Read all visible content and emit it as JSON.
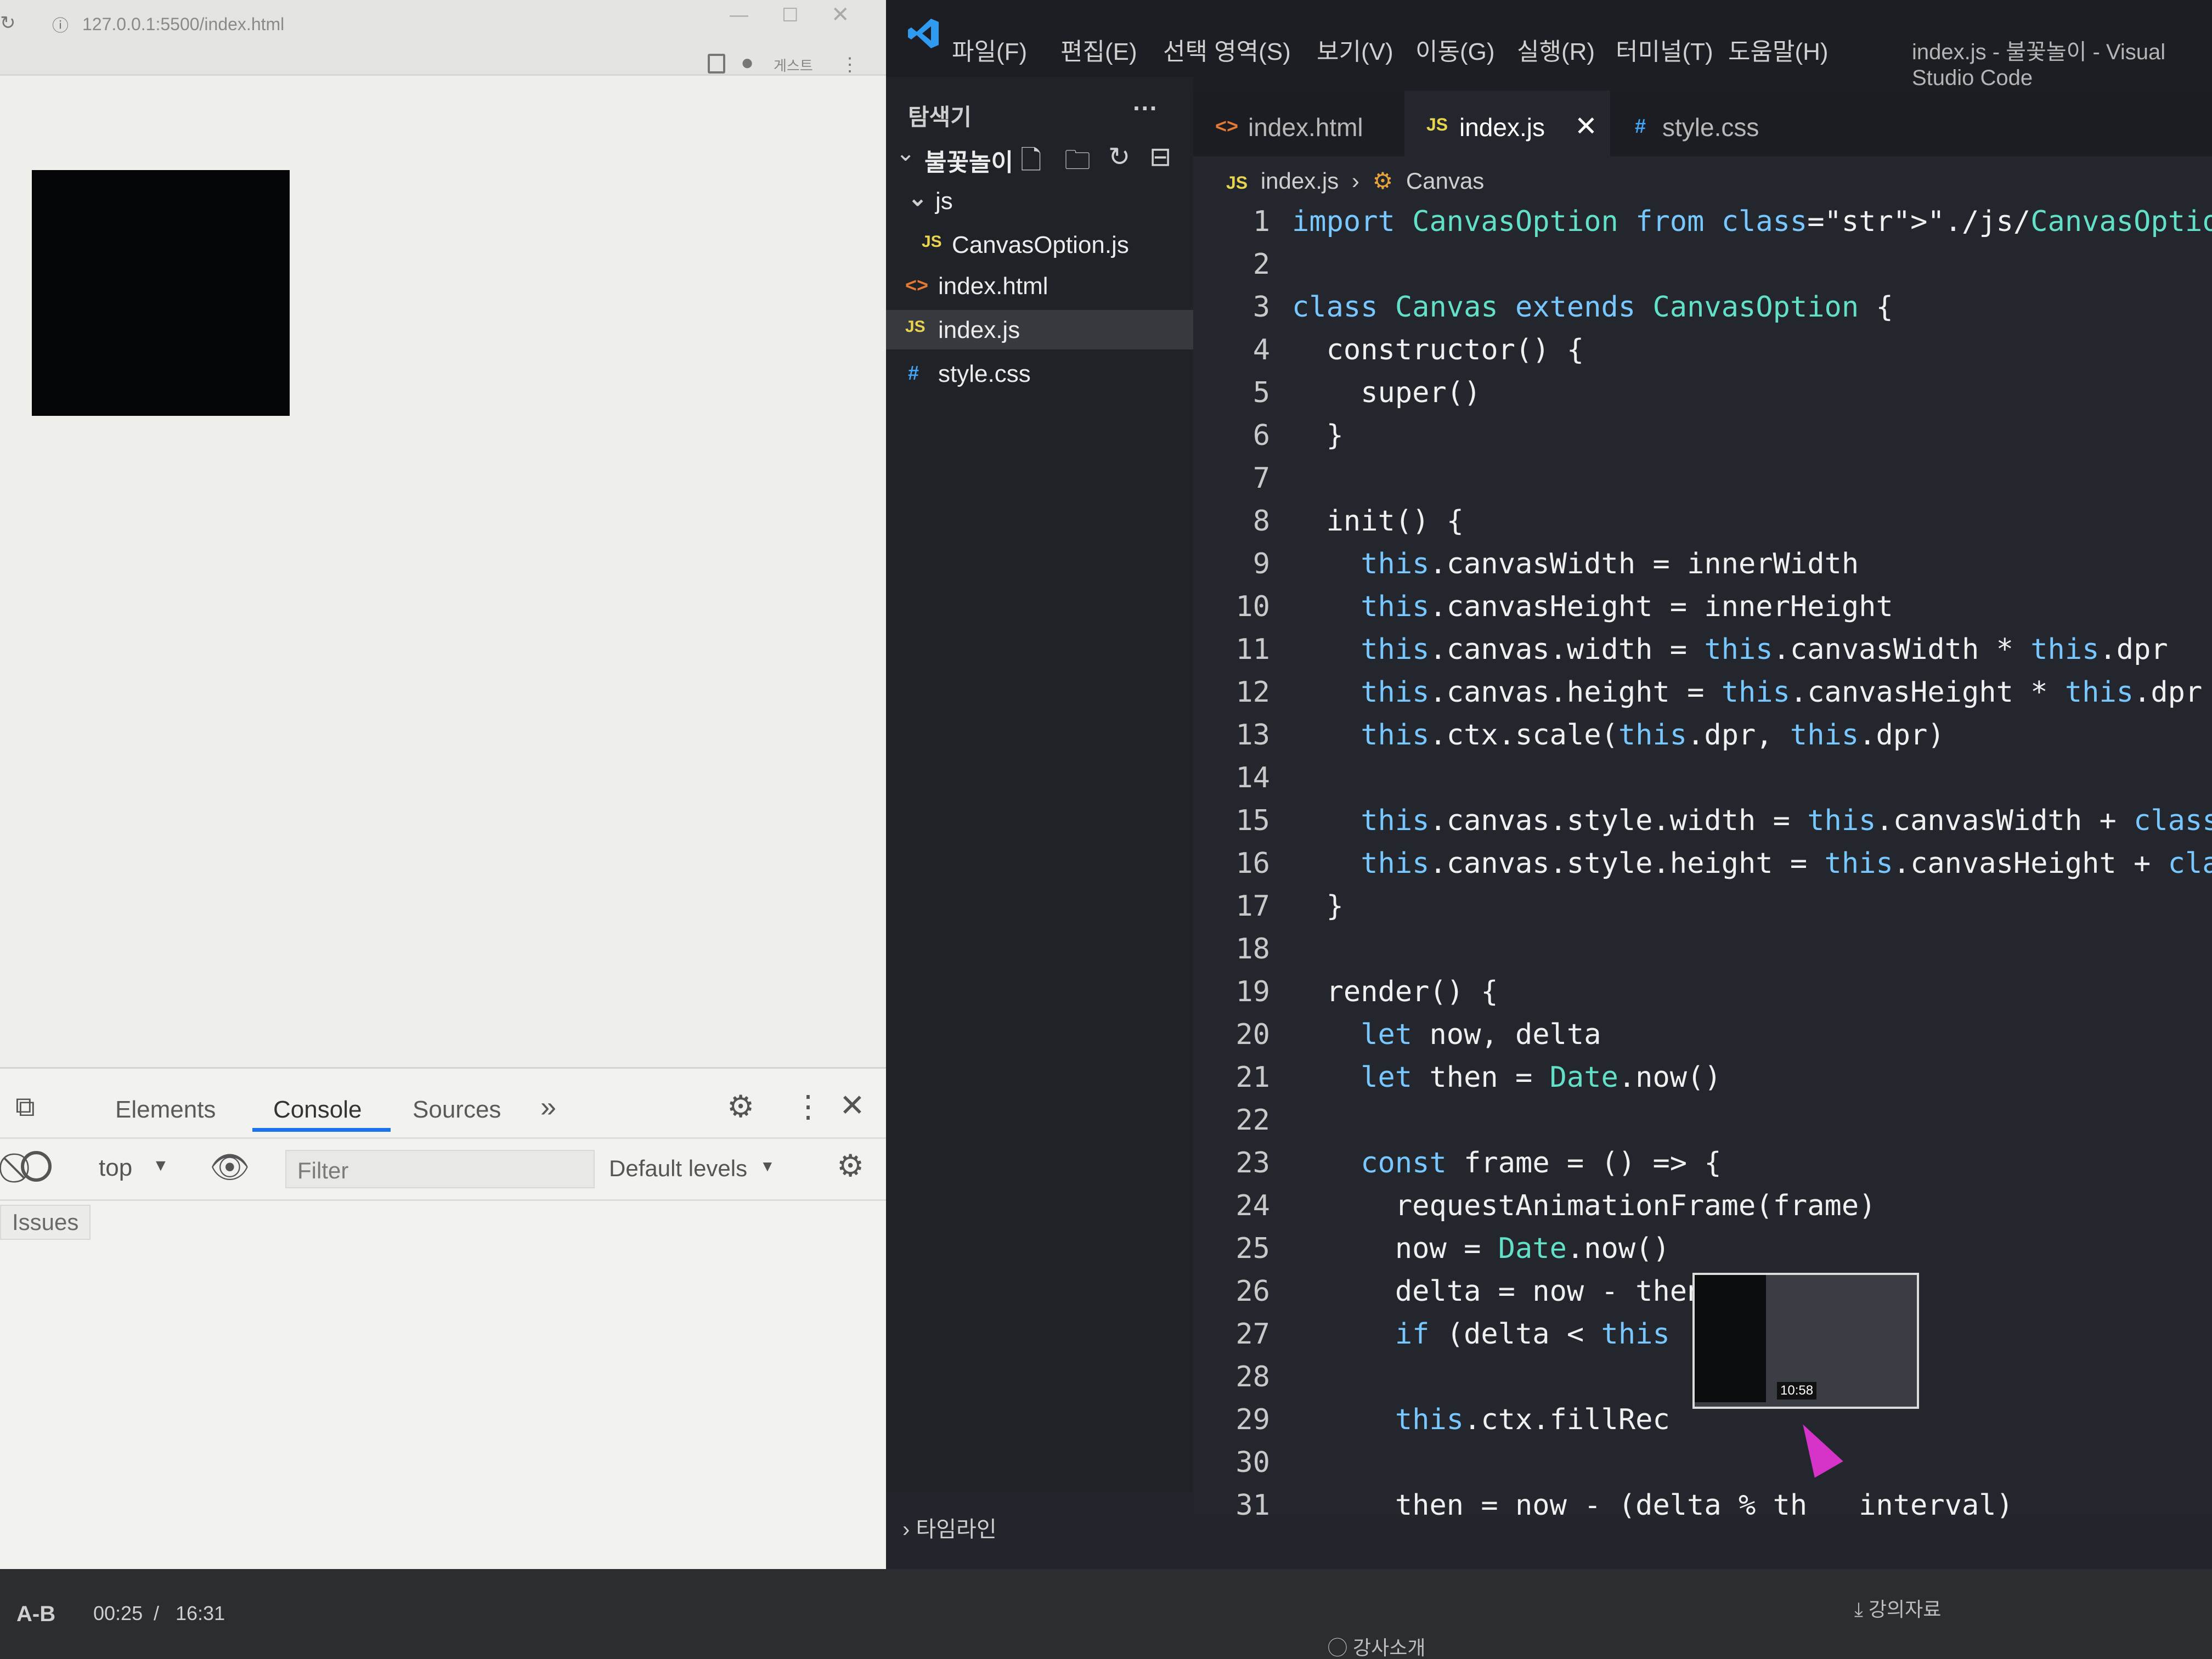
{
  "browser": {
    "url": "127.0.0.1:5500/index.html",
    "profile_label": "게스트"
  },
  "devtools": {
    "tabs": [
      "Elements",
      "Console",
      "Sources"
    ],
    "more_tabs": "»",
    "context": "top",
    "filter_placeholder": "Filter",
    "levels": "Default levels",
    "issues_label": "Issues"
  },
  "vscode": {
    "menu": [
      "파일(F)",
      "편집(E)",
      "선택 영역(S)",
      "보기(V)",
      "이동(G)",
      "실행(R)",
      "터미널(T)",
      "도움말(H)"
    ],
    "window_title": "index.js - 불꽃놀이 - Visual Studio Code",
    "explorer_title": "탐색기",
    "explorer_more": "···",
    "project_name": "불꽃놀이",
    "tree": [
      {
        "label": "js",
        "kind": "folder"
      },
      {
        "label": "CanvasOption.js",
        "kind": "js"
      },
      {
        "label": "index.html",
        "kind": "html"
      },
      {
        "label": "index.js",
        "kind": "js",
        "active": true
      },
      {
        "label": "style.css",
        "kind": "css"
      }
    ],
    "tabs": [
      {
        "label": "index.html",
        "icon": "<>"
      },
      {
        "label": "index.js",
        "icon": "JS",
        "active": true
      },
      {
        "label": "style.css",
        "icon": "#"
      }
    ],
    "breadcrumb": [
      "index.js",
      "Canvas"
    ],
    "timeline_label": "타임라인",
    "code_lines": [
      "import CanvasOption from \"./js/CanvasOption.js\"",
      "",
      "class Canvas extends CanvasOption {",
      "  constructor() {",
      "    super()",
      "  }",
      "",
      "  init() {",
      "    this.canvasWidth = innerWidth",
      "    this.canvasHeight = innerHeight",
      "    this.canvas.width = this.canvasWidth * this.dpr",
      "    this.canvas.height = this.canvasHeight * this.dpr",
      "    this.ctx.scale(this.dpr, this.dpr)",
      "",
      "    this.canvas.style.width = this.canvasWidth + 'px'",
      "    this.canvas.style.height = this.canvasHeight + 'px'",
      "  }",
      "",
      "  render() {",
      "    let now, delta",
      "    let then = Date.now()",
      "",
      "    const frame = () => {",
      "      requestAnimationFrame(frame)",
      "      now = Date.now()",
      "      delta = now - then",
      "      if (delta < this",
      "",
      "      this.ctx.fillRec",
      "",
      "      then = now - (delta % th   interval)"
    ]
  },
  "thumbnail": {
    "time": "10:58"
  },
  "player": {
    "ab": "A-B",
    "current": "00:25",
    "sep": "/",
    "total": "16:31",
    "instructor": "강사소개",
    "materials": "강의자료"
  },
  "colors": {
    "accent": "#1a73e8",
    "cursor": "#d633c8",
    "vscode_blue": "#3ba9ff"
  }
}
